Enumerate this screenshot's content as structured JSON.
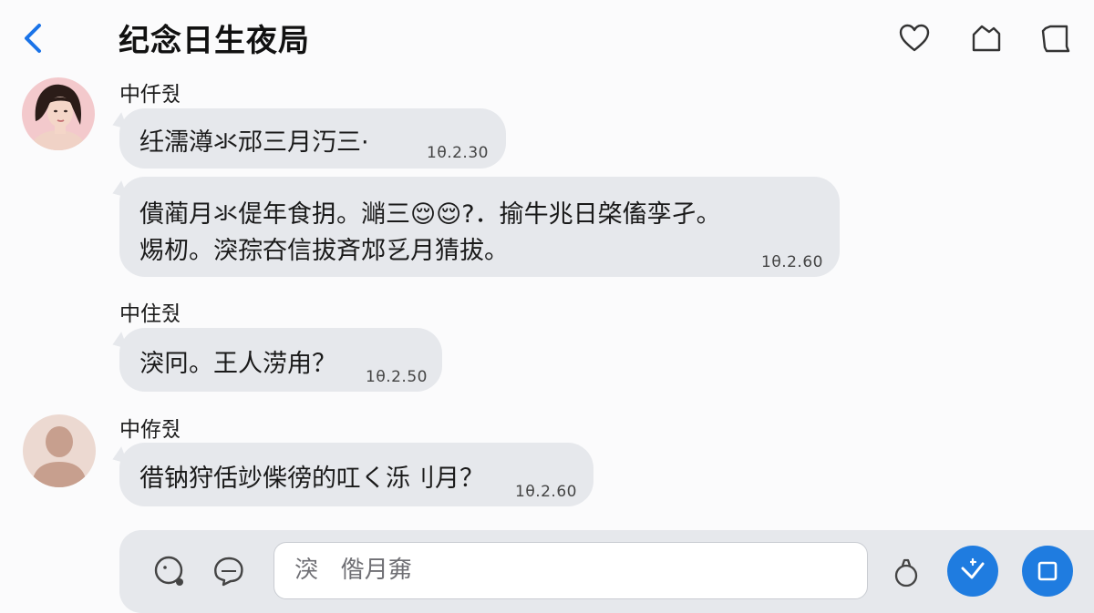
{
  "header": {
    "title": "纪念日生夜局",
    "icons": [
      "back-chevron-icon",
      "heart-icon",
      "tag-icon",
      "frame-icon"
    ]
  },
  "messages": [
    {
      "sender": "中仟줬",
      "avatar": "woman-photo-avatar",
      "bubbles": [
        {
          "text": "纴濡澊氺邧三月汅三·",
          "time": "1θ.2.30"
        },
        {
          "lines": [
            "僓蔺月氺偍年食抈。㴥三😌😌?．揄牛兆日棨傗孪孑。",
            "焬杒。湥孮夻信拔斉邥乥月猜拔。"
          ],
          "time": "1θ.2.60"
        }
      ]
    },
    {
      "sender": "中住줬",
      "bubbles": [
        {
          "text": "湥冋。王人涝甪？",
          "time": "1θ.2.50"
        }
      ]
    },
    {
      "sender": "中侟줬",
      "avatar": "placeholder-person-avatar",
      "bubbles": [
        {
          "text": "徣钠狩佸竗偨徬的叿く泺刂月？",
          "time": "1θ.2.60"
        }
      ]
    }
  ],
  "composer": {
    "input_value": "湥   偺月㚕",
    "icons": [
      "emoji-icon",
      "chat-bubble-icon",
      "mic-icon",
      "sticker-icon",
      "stop-icon"
    ],
    "accent": "#1f7ce0"
  }
}
